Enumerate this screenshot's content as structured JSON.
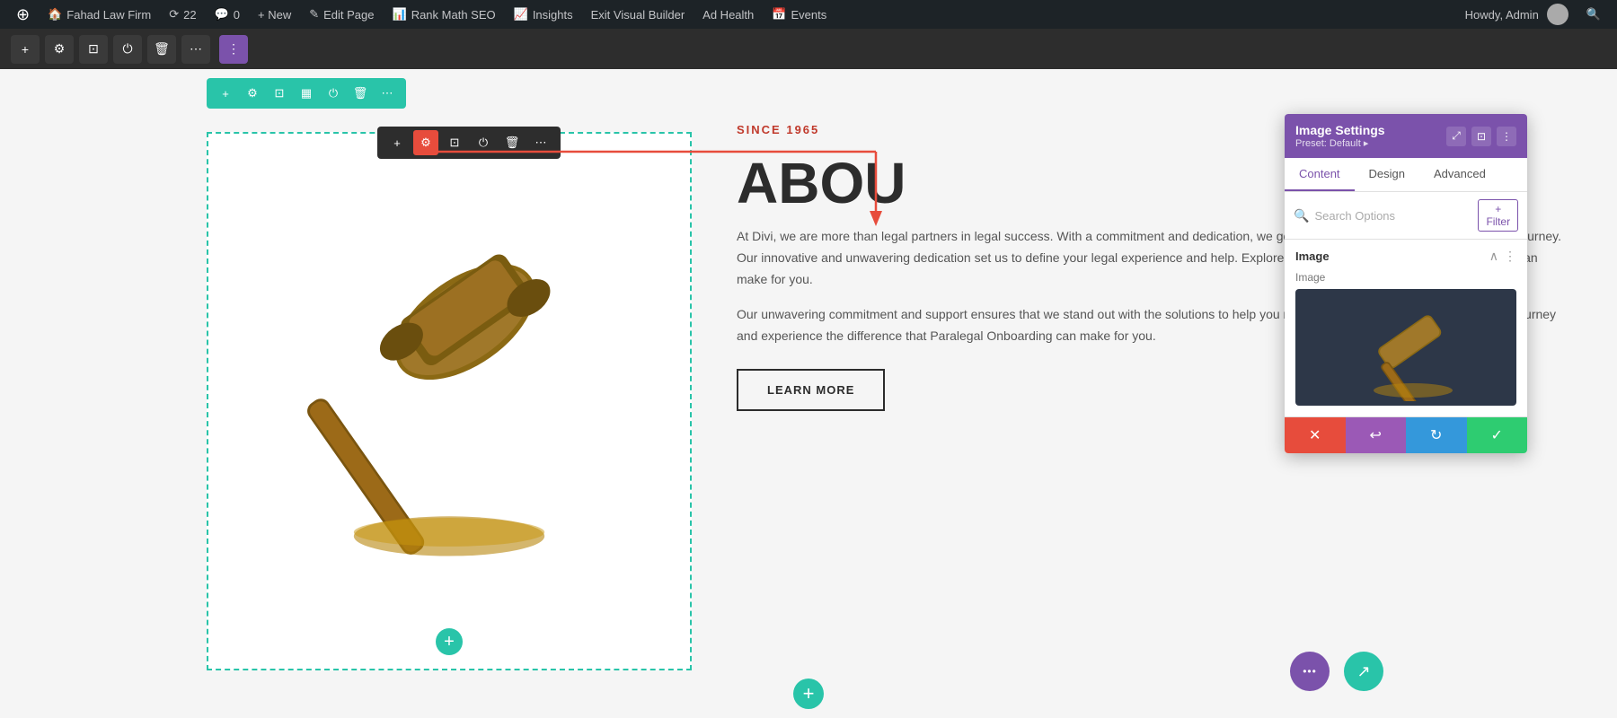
{
  "site": {
    "name": "Fahad Law Firm",
    "admin_label": "Howdy, Admin"
  },
  "admin_bar": {
    "wp_icon": "⊕",
    "items": [
      {
        "label": "Fahad Law Firm",
        "icon": "🏠"
      },
      {
        "label": "22",
        "icon": "⟳",
        "has_bubble": true
      },
      {
        "label": "0",
        "icon": "💬",
        "has_bubble": false
      },
      {
        "label": "+ New"
      },
      {
        "label": "Edit Page",
        "icon": "✎"
      },
      {
        "label": "Rank Math SEO",
        "icon": "📊"
      },
      {
        "label": "Insights",
        "icon": "📈"
      },
      {
        "label": "Exit Visual Builder"
      },
      {
        "label": "Ad Health"
      },
      {
        "label": "Events",
        "icon": "📅"
      }
    ],
    "howdy": "Howdy, Admin",
    "search_icon": "🔍"
  },
  "divi_bar": {
    "buttons": [
      "+",
      "⚙",
      "⊡",
      "⏻",
      "🗑",
      "⋯"
    ]
  },
  "section_toolbar": {
    "buttons": [
      "+",
      "⚙",
      "⊡",
      "▦",
      "⏻",
      "🗑",
      "⋯"
    ]
  },
  "image_toolbar": {
    "buttons": [
      "+",
      "⚙",
      "⊡",
      "⏻",
      "🗑",
      "⋯"
    ],
    "highlighted_index": 1
  },
  "page": {
    "since_label": "SINCE 1965",
    "title": "ABOU",
    "body_text_1": "At Divi, we are more than legal partners in legal success. With a commitment and dedication, we go above and beyond to keep of their legal journey. Our innovative and unwavering dedication set us to define your legal experience and help. Explore the difference that Paralegal Onboarding can make for you.",
    "body_text_2": "Our unwavering commitment and support ensures that we stand out with the solutions to help you reach your goals and make for your legal journey and experience the difference that Paralegal Onboarding can make for you.",
    "learn_more_label": "Learn More"
  },
  "image_settings_panel": {
    "title": "Image Settings",
    "preset": "Preset: Default ▸",
    "tabs": [
      "Content",
      "Design",
      "Advanced"
    ],
    "active_tab": "Content",
    "search_placeholder": "Search Options",
    "filter_label": "+ Filter",
    "section_title": "Image",
    "image_label": "Image",
    "footer_buttons": [
      {
        "icon": "✕",
        "type": "cancel"
      },
      {
        "icon": "↩",
        "type": "undo"
      },
      {
        "icon": "↻",
        "type": "redo"
      },
      {
        "icon": "✓",
        "type": "confirm"
      }
    ]
  },
  "fab": {
    "dots_icon": "•••",
    "chart_icon": "📊",
    "add_icon": "+"
  },
  "colors": {
    "teal": "#29c4a9",
    "purple": "#7b52ab",
    "red": "#e74c3c",
    "dark": "#2d2d2d",
    "admin_bg": "#1d2327"
  }
}
